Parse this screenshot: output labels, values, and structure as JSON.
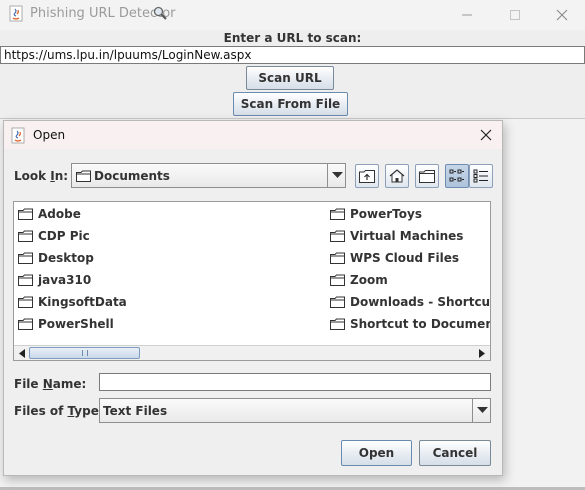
{
  "main_window": {
    "title": "Phishing URL Detector",
    "url_prompt": "Enter a URL to scan:",
    "url_value": "https://ums.lpu.in/lpuums/LoginNew.aspx",
    "scan_url_label": "Scan URL",
    "scan_file_label": "Scan From File"
  },
  "dialog": {
    "title": "Open",
    "look_in_label_pre": "Look ",
    "look_in_label_ul": "I",
    "look_in_label_post": "n:",
    "look_in_value": "Documents",
    "files_col1": [
      "Adobe",
      "CDP Pic",
      "Desktop",
      "java310",
      "KingsoftData",
      "PowerShell"
    ],
    "files_col2": [
      "PowerToys",
      "Virtual Machines",
      "WPS Cloud Files",
      "Zoom",
      "Downloads - Shortcut",
      "Shortcut to Documents ("
    ],
    "file_name_label_pre": "File ",
    "file_name_label_ul": "N",
    "file_name_label_post": "ame:",
    "file_name_value": "",
    "files_type_label_pre": "Files of ",
    "files_type_label_ul": "T",
    "files_type_label_post": "ype:",
    "files_type_value": "Text Files",
    "open_label": "Open",
    "cancel_label": "Cancel"
  },
  "icons": {
    "app": "java-cup-icon",
    "title_decoration": "magnifier-icon",
    "folder": "folder-icon",
    "up": "up-folder-icon",
    "home": "home-icon",
    "new_folder": "new-folder-icon",
    "list_view": "list-view-icon",
    "details_view": "details-view-icon"
  },
  "colors": {
    "window_bg": "#eeeeee",
    "dialog_title_bg": "#f9f1f1",
    "selected_toggle": "#aec3dc"
  }
}
